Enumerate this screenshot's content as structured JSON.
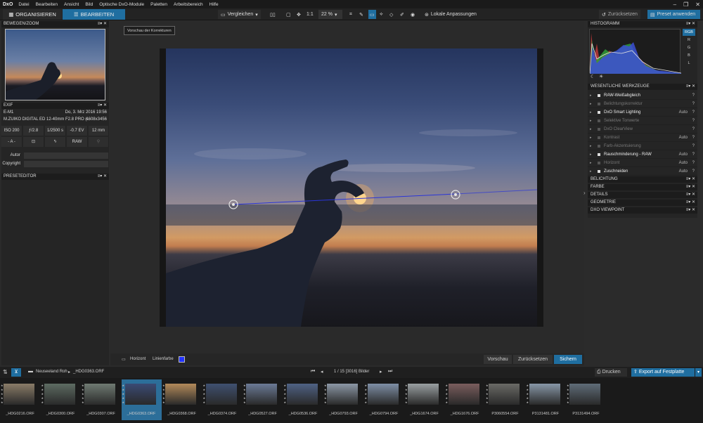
{
  "menubar": {
    "logo": "DxO",
    "items": [
      "Datei",
      "Bearbeiten",
      "Ansicht",
      "Bild",
      "Optische DxO-Module",
      "Paletten",
      "Arbeitsbereich",
      "Hilfe"
    ],
    "win": [
      "‒",
      "❐",
      "✕"
    ]
  },
  "toolbar": {
    "tab_organize": "ORGANISIEREN",
    "tab_edit": "BEARBEITEN",
    "compare": "Vergleichen",
    "ratio": "1:1",
    "zoom": "22 %",
    "local_adjust": "Lokale Anpassungen",
    "reset": "Zurücksetzen",
    "apply_preset": "Preset anwenden",
    "accent": "#1f6ea0"
  },
  "left": {
    "nav_header": "BEWEGEN/ZOOM",
    "exif_header": "EXIF",
    "camera": "E-M1",
    "date": "Do, 3. Mrz 2016 19:56",
    "lens": "M.ZUIKO DIGITAL ED 12-40mm F2.8 PRO (...",
    "dims": "4608x3456",
    "iso": "ISO 200",
    "aperture": "ƒ/2.8",
    "shutter": "1/2500 s",
    "ev": "-0.7 EV",
    "focal": "12 mm",
    "mode": "- A -",
    "format": "RAW",
    "author_label": "Autor",
    "copyright_label": "Copyright",
    "preset_header": "PRESETEDITOR",
    "header_controls": "≡▾ ✕"
  },
  "main": {
    "tooltip": "Vorschau der Korrekturen"
  },
  "bottombar": {
    "horizon": "Horizont",
    "line_color_label": "Linienfarbe",
    "line_color": "#2233ff",
    "preview": "Vorschau",
    "reset": "Zurücksetzen",
    "save": "Sichern"
  },
  "right": {
    "histogram_header": "HISTOGRAMM",
    "channels": [
      "RGB",
      "R",
      "G",
      "B",
      "L"
    ],
    "essential_header": "WESENTLICHE WERKZEUGE",
    "tools": [
      {
        "name": "RAW-Weißabgleich",
        "on": true,
        "auto": ""
      },
      {
        "name": "Belichtungskorrektur",
        "on": false,
        "auto": ""
      },
      {
        "name": "DxO Smart Lighting",
        "on": true,
        "auto": "Auto"
      },
      {
        "name": "Selektive Tonwerte",
        "on": false,
        "auto": ""
      },
      {
        "name": "DxO ClearView",
        "on": false,
        "auto": ""
      },
      {
        "name": "Kontrast",
        "on": false,
        "auto": "Auto"
      },
      {
        "name": "Farb-Akzentuierung",
        "on": false,
        "auto": ""
      },
      {
        "name": "Rauschminderung - RAW",
        "on": true,
        "auto": "Auto"
      },
      {
        "name": "Horizont",
        "on": false,
        "auto": "Auto"
      },
      {
        "name": "Zuschneiden",
        "on": true,
        "auto": "Auto"
      }
    ],
    "sections": [
      "BELICHTUNG",
      "FARBE",
      "DETAILS",
      "GEOMETRIE",
      "DXO VIEWPOINT"
    ]
  },
  "filmbar": {
    "folder": "Neuseeland Roh",
    "file": "_HDG0363.ORF",
    "counter": "1 / 15 [3016] Bilder",
    "print": "Drucken",
    "export": "Export auf Festplatte"
  },
  "films": [
    {
      "name": "_HDG0216.ORF",
      "color": "#8a7c68"
    },
    {
      "name": "_HDG0300.ORF",
      "color": "#5d6b62"
    },
    {
      "name": "_HDG0307.ORF",
      "color": "#6f7a72"
    },
    {
      "name": "_HDG0363.ORF",
      "color": "#3a4a74",
      "selected": true
    },
    {
      "name": "_HDG0368.ORF",
      "color": "#b38a5a"
    },
    {
      "name": "_HDG0374.ORF",
      "color": "#3f5070"
    },
    {
      "name": "_HDG0527.ORF",
      "color": "#6b7a96"
    },
    {
      "name": "_HDG0536.ORF",
      "color": "#4f6284"
    },
    {
      "name": "_HDG0793.ORF",
      "color": "#8c98a6"
    },
    {
      "name": "_HDG0794.ORF",
      "color": "#7e8fa6"
    },
    {
      "name": "_HDG1674.ORF",
      "color": "#9aa0a2"
    },
    {
      "name": "_HDG1676.ORF",
      "color": "#7a5d5d"
    },
    {
      "name": "P3060554.ORF",
      "color": "#6a6a66"
    },
    {
      "name": "P3131481.ORF",
      "color": "#8898a8"
    },
    {
      "name": "P3131494.ORF",
      "color": "#5f6c78"
    }
  ]
}
